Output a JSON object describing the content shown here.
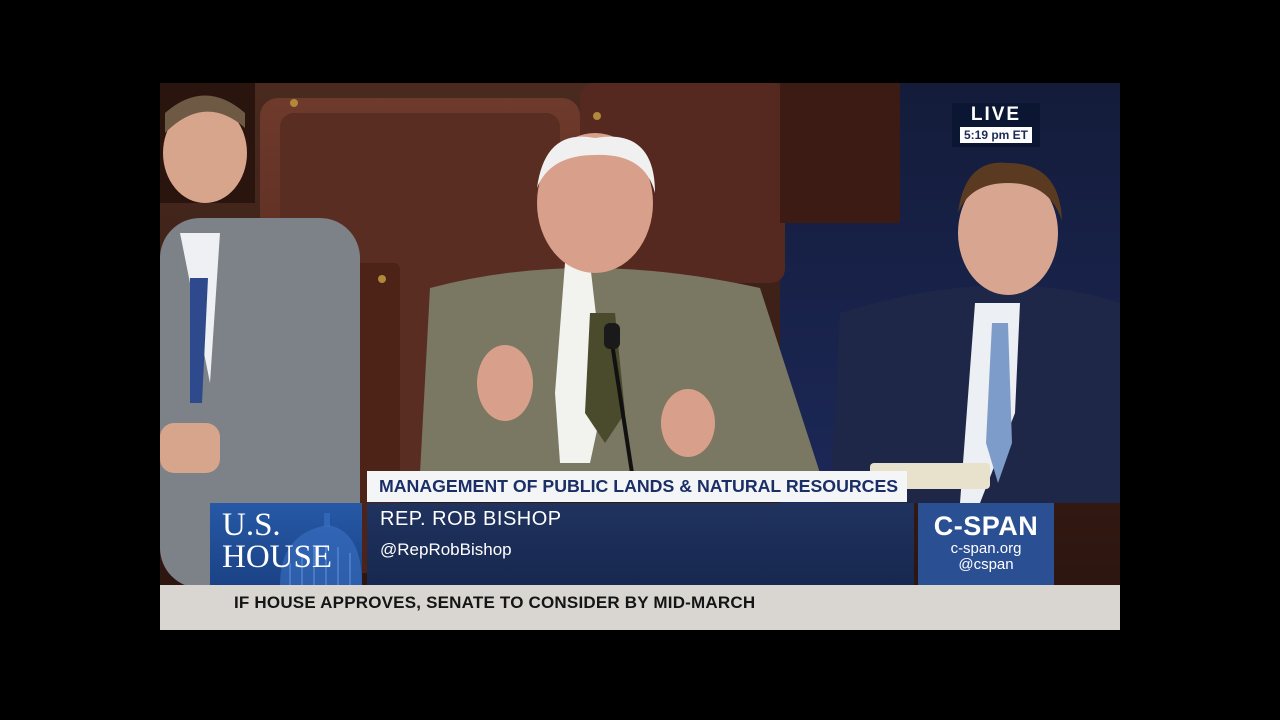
{
  "bug": {
    "live_label": "LIVE",
    "time": "5:19 pm ET"
  },
  "lower_third": {
    "headline": "MANAGEMENT OF PUBLIC LANDS & NATURAL RESOURCES",
    "speaker_name": "REP. ROB BISHOP",
    "speaker_handle": "@RepRobBishop"
  },
  "house_logo": {
    "line1": "U.S.",
    "line2": "HOUSE"
  },
  "cspan_logo": {
    "name": "C-SPAN",
    "url": "c-span.org",
    "handle": "@cspan"
  },
  "ticker": {
    "text": "IF HOUSE APPROVES, SENATE TO CONSIDER BY MID-MARCH"
  },
  "colors": {
    "navy": "#1b2f66",
    "house_blue": "#2659a6",
    "cspan_blue": "#2b4f93",
    "ticker_gray": "#d9d6d2"
  }
}
